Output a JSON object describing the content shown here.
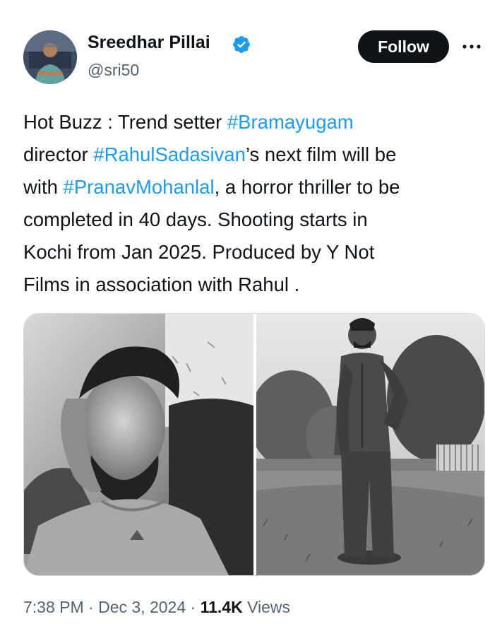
{
  "author": {
    "display_name": "Sreedhar Pillai",
    "handle": "@sri50",
    "verified": true
  },
  "follow_label": "Follow",
  "tweet": {
    "lines": [
      [
        {
          "text": "Hot Buzz : Trend setter "
        },
        {
          "text": "#Bramayugam",
          "hashtag": true
        }
      ],
      [
        {
          "text": "director "
        },
        {
          "text": "#RahulSadasivan",
          "hashtag": true
        },
        {
          "text": "’s next film will be"
        }
      ],
      [
        {
          "text": "with "
        },
        {
          "text": "#PranavMohanlal",
          "hashtag": true
        },
        {
          "text": ", a horror thriller to be"
        }
      ],
      [
        {
          "text": "completed in 40 days. Shooting starts in"
        }
      ],
      [
        {
          "text": "Kochi from Jan 2025. Produced by  Y Not"
        }
      ],
      [
        {
          "text": "Films in association with Rahul ."
        }
      ]
    ]
  },
  "meta": {
    "time": "7:38 PM",
    "separator": "·",
    "date": "Dec 3, 2024",
    "views_count": "11.4K",
    "views_label": "Views"
  },
  "colors": {
    "text": "#0f1419",
    "secondary": "#536471",
    "link": "#1d9bf0",
    "follow_bg": "#0f1419"
  },
  "icons": {
    "verified": "verified-badge-icon",
    "more": "more-options-icon"
  }
}
